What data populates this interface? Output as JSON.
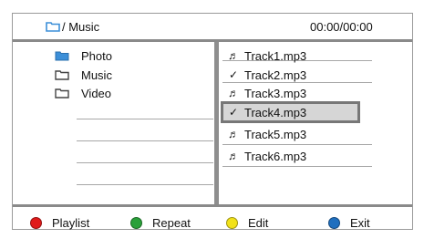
{
  "header": {
    "path_label": "/ Music",
    "time": "00:00/00:00",
    "path_icon": "folder-icon"
  },
  "folders": [
    {
      "label": "Photo",
      "icon": "folder-icon",
      "color": "#3c8fd8"
    },
    {
      "label": "Music",
      "icon": "folder-icon",
      "color": "#555555"
    },
    {
      "label": "Video",
      "icon": "folder-icon",
      "color": "#555555"
    }
  ],
  "tracks": [
    {
      "label": "Track1.mp3",
      "icon": "music-note-icon",
      "glyph": "♬"
    },
    {
      "label": "Track2.mp3",
      "icon": "check-icon",
      "glyph": "✓"
    },
    {
      "label": "Track3.mp3",
      "icon": "music-note-icon",
      "glyph": "♬"
    },
    {
      "label": "Track4.mp3",
      "icon": "check-icon",
      "glyph": "✓",
      "selected": true
    },
    {
      "label": "Track5.mp3",
      "icon": "music-note-icon",
      "glyph": "♬"
    },
    {
      "label": "Track6.mp3",
      "icon": "music-note-icon",
      "glyph": "♬"
    }
  ],
  "footer": {
    "buttons": [
      {
        "label": "Playlist",
        "color": "#e01a1a"
      },
      {
        "label": "Repeat",
        "color": "#2aa03a"
      },
      {
        "label": "Edit",
        "color": "#f2e21a"
      },
      {
        "label": "Exit",
        "color": "#1f6fbf"
      }
    ]
  }
}
